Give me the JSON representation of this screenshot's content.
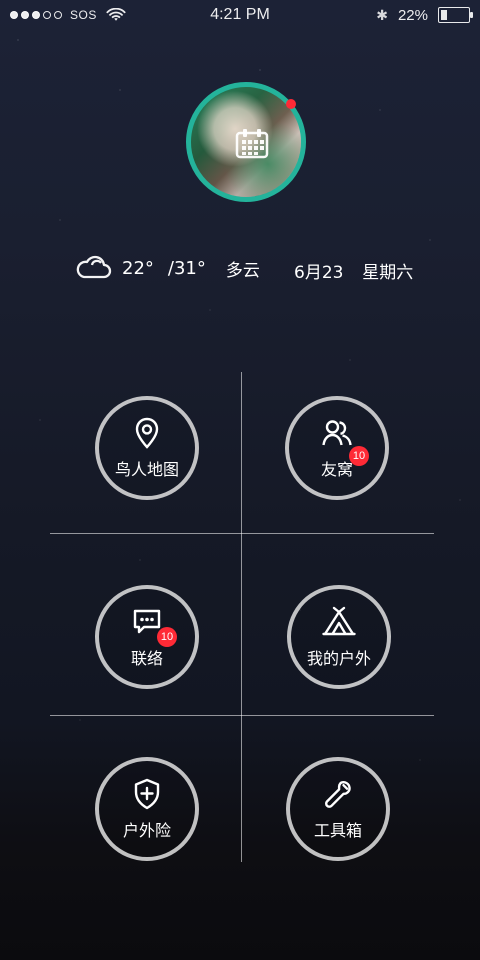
{
  "status_bar": {
    "carrier": "SOS",
    "time": "4:21 PM",
    "battery_text": "22%",
    "battery_level_percent": 22,
    "signal_filled_dots": 3,
    "signal_total_dots": 5
  },
  "profile": {
    "notification": true
  },
  "weather": {
    "low": "22°",
    "high": "/31°",
    "condition": "多云",
    "date": "6月23",
    "weekday": "星期六",
    "icon": "cloud-icon"
  },
  "menu": {
    "map": {
      "label": "鸟人地图",
      "icon": "location-pin-icon"
    },
    "friends": {
      "label": "友窝",
      "badge": "10",
      "icon": "friends-icon"
    },
    "messages": {
      "label": "联络",
      "badge": "10",
      "icon": "message-icon"
    },
    "outdoor": {
      "label": "我的户外",
      "icon": "tent-icon"
    },
    "insurance": {
      "label": "户外险",
      "icon": "shield-plus-icon"
    },
    "tools": {
      "label": "工具箱",
      "icon": "wrench-icon"
    }
  },
  "colors": {
    "accent": "#24b39b",
    "badge": "#ff2a36",
    "circle_border": "#e1e1e1"
  }
}
